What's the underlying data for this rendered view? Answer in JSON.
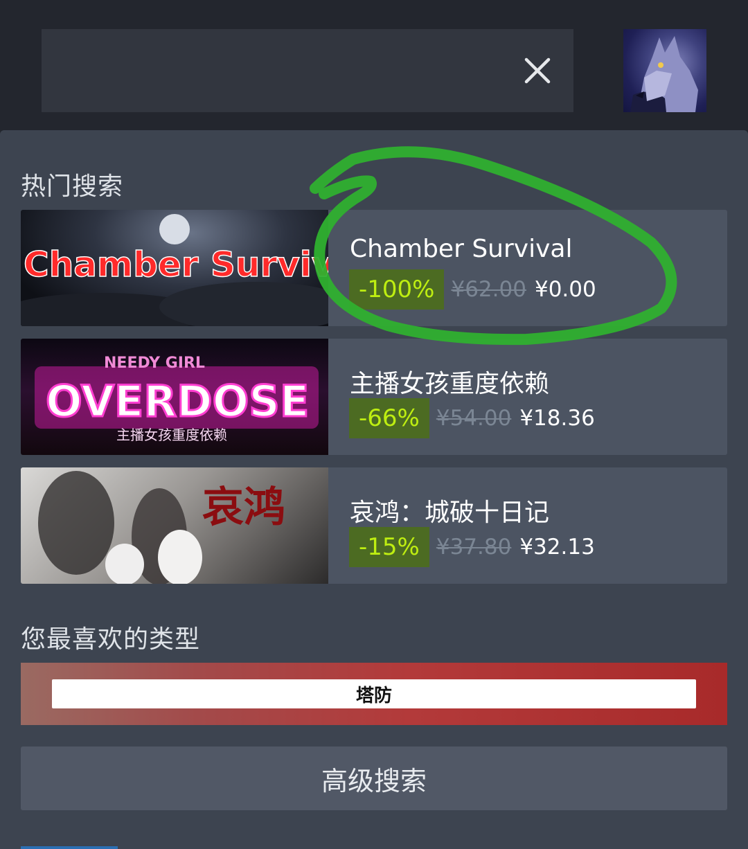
{
  "header": {
    "search_value": "",
    "clear_icon": "close-icon",
    "avatar": "wolf-avatar"
  },
  "popular": {
    "title": "热门搜索",
    "results": [
      {
        "name": "Chamber Survival",
        "discount": "-100%",
        "original_price": "¥62.00",
        "final_price": "¥0.00",
        "capsule_text": "Chamber Survival"
      },
      {
        "name": "主播女孩重度依赖",
        "discount": "-66%",
        "original_price": "¥54.00",
        "final_price": "¥18.36",
        "capsule_text": "OVERDOSE",
        "capsule_subtext": "主播女孩重度依赖",
        "capsule_top_text": "NEEDY GIRL"
      },
      {
        "name": "哀鸿：城破十日记",
        "discount": "-15%",
        "original_price": "¥37.80",
        "final_price": "¥32.13",
        "capsule_text": "哀鸿"
      }
    ]
  },
  "favorites": {
    "title": "您最喜欢的类型",
    "genre": "塔防"
  },
  "advanced_search": {
    "label": "高级搜索"
  },
  "colors": {
    "background": "#23262e",
    "panel": "#3d4450",
    "discount_bg": "#4c6b22",
    "discount_text": "#beee11",
    "annotation": "#2fb02f"
  }
}
